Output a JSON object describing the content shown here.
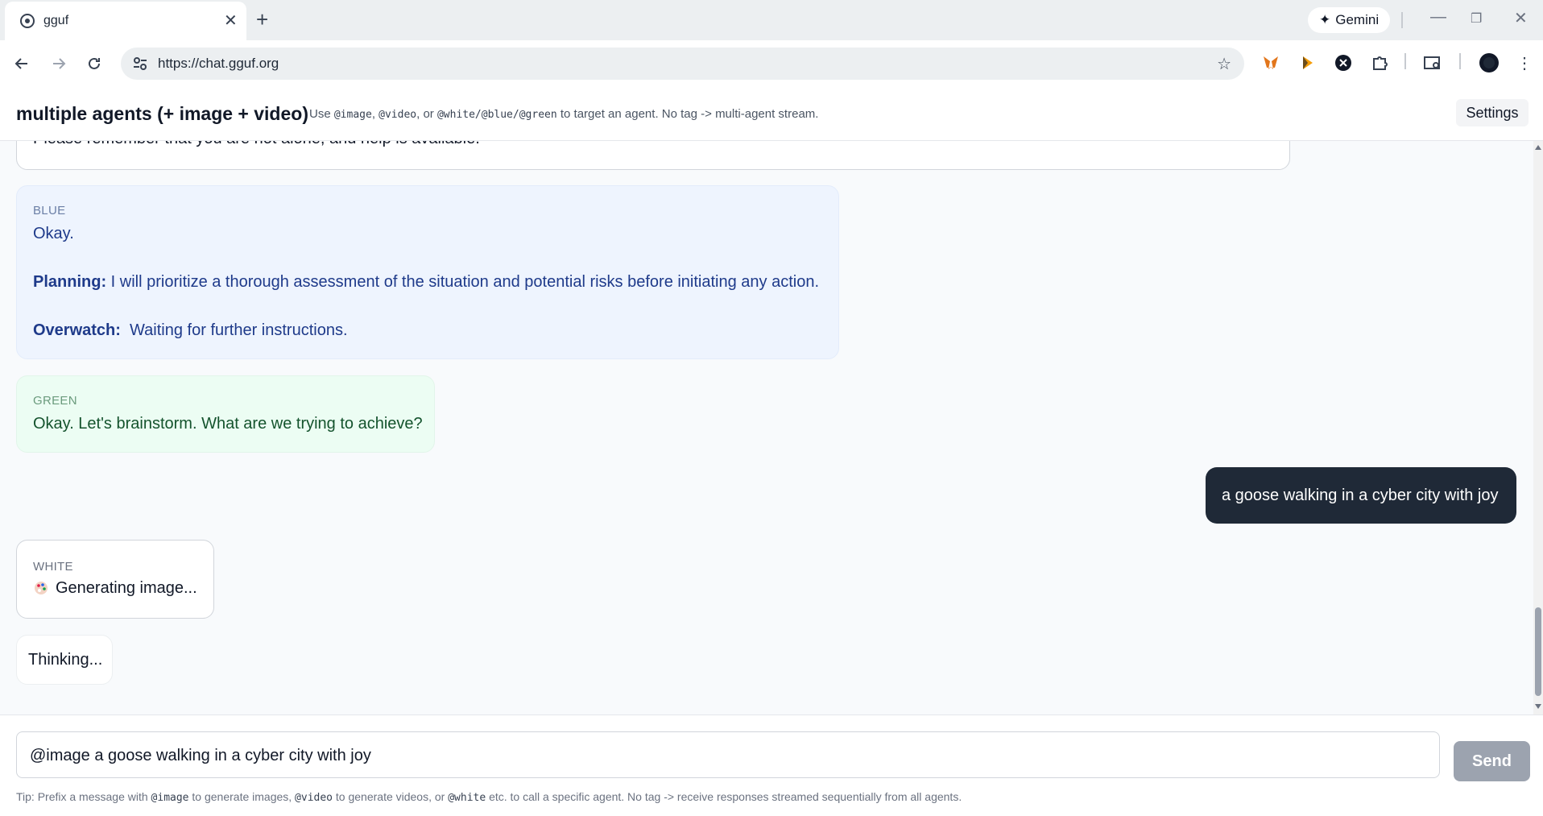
{
  "browser": {
    "tab_title": "gguf",
    "url": "https://chat.gguf.org",
    "gemini_label": "Gemini"
  },
  "header": {
    "title": "multiple agents (+ image + video)",
    "sub_use": "Use ",
    "tag_image": "@image",
    "sub_comma1": ", ",
    "tag_video": "@video",
    "sub_or": ", or ",
    "tag_agents": "@white/@blue/@green",
    "sub_end": " to target an agent. No tag -> multi-agent stream.",
    "settings_label": "Settings"
  },
  "messages": {
    "previous_text": "Please remember that you are not alone, and help is available.",
    "blue": {
      "agent": "BLUE",
      "line1": "Okay.",
      "planning_label": "Planning:",
      "planning_text": " I will prioritize a thorough assessment of the situation and potential risks before initiating any action.",
      "overwatch_label": "Overwatch:",
      "overwatch_text": "  Waiting for further instructions."
    },
    "green": {
      "agent": "GREEN",
      "text": "Okay. Let's brainstorm. What are we trying to achieve?"
    },
    "user": {
      "text": "a goose walking in a cyber city with joy"
    },
    "white": {
      "agent": "WHITE",
      "text": "Generating image..."
    },
    "thinking": "Thinking..."
  },
  "composer": {
    "input_value": "@image a goose walking in a cyber city with joy",
    "send_label": "Send",
    "tip_prefix": "Tip: Prefix a message with ",
    "tip_image": "@image",
    "tip_mid1": " to generate images, ",
    "tip_video": "@video",
    "tip_mid2": " to generate videos, or ",
    "tip_white": "@white",
    "tip_end": " etc. to call a specific agent. No tag -> receive responses streamed sequentially from all agents."
  },
  "colors": {
    "blue_bubble": "#eef4fe",
    "green_bubble": "#ecfdf3",
    "user_bubble": "#1f2937",
    "send_disabled": "#9ca3af"
  }
}
